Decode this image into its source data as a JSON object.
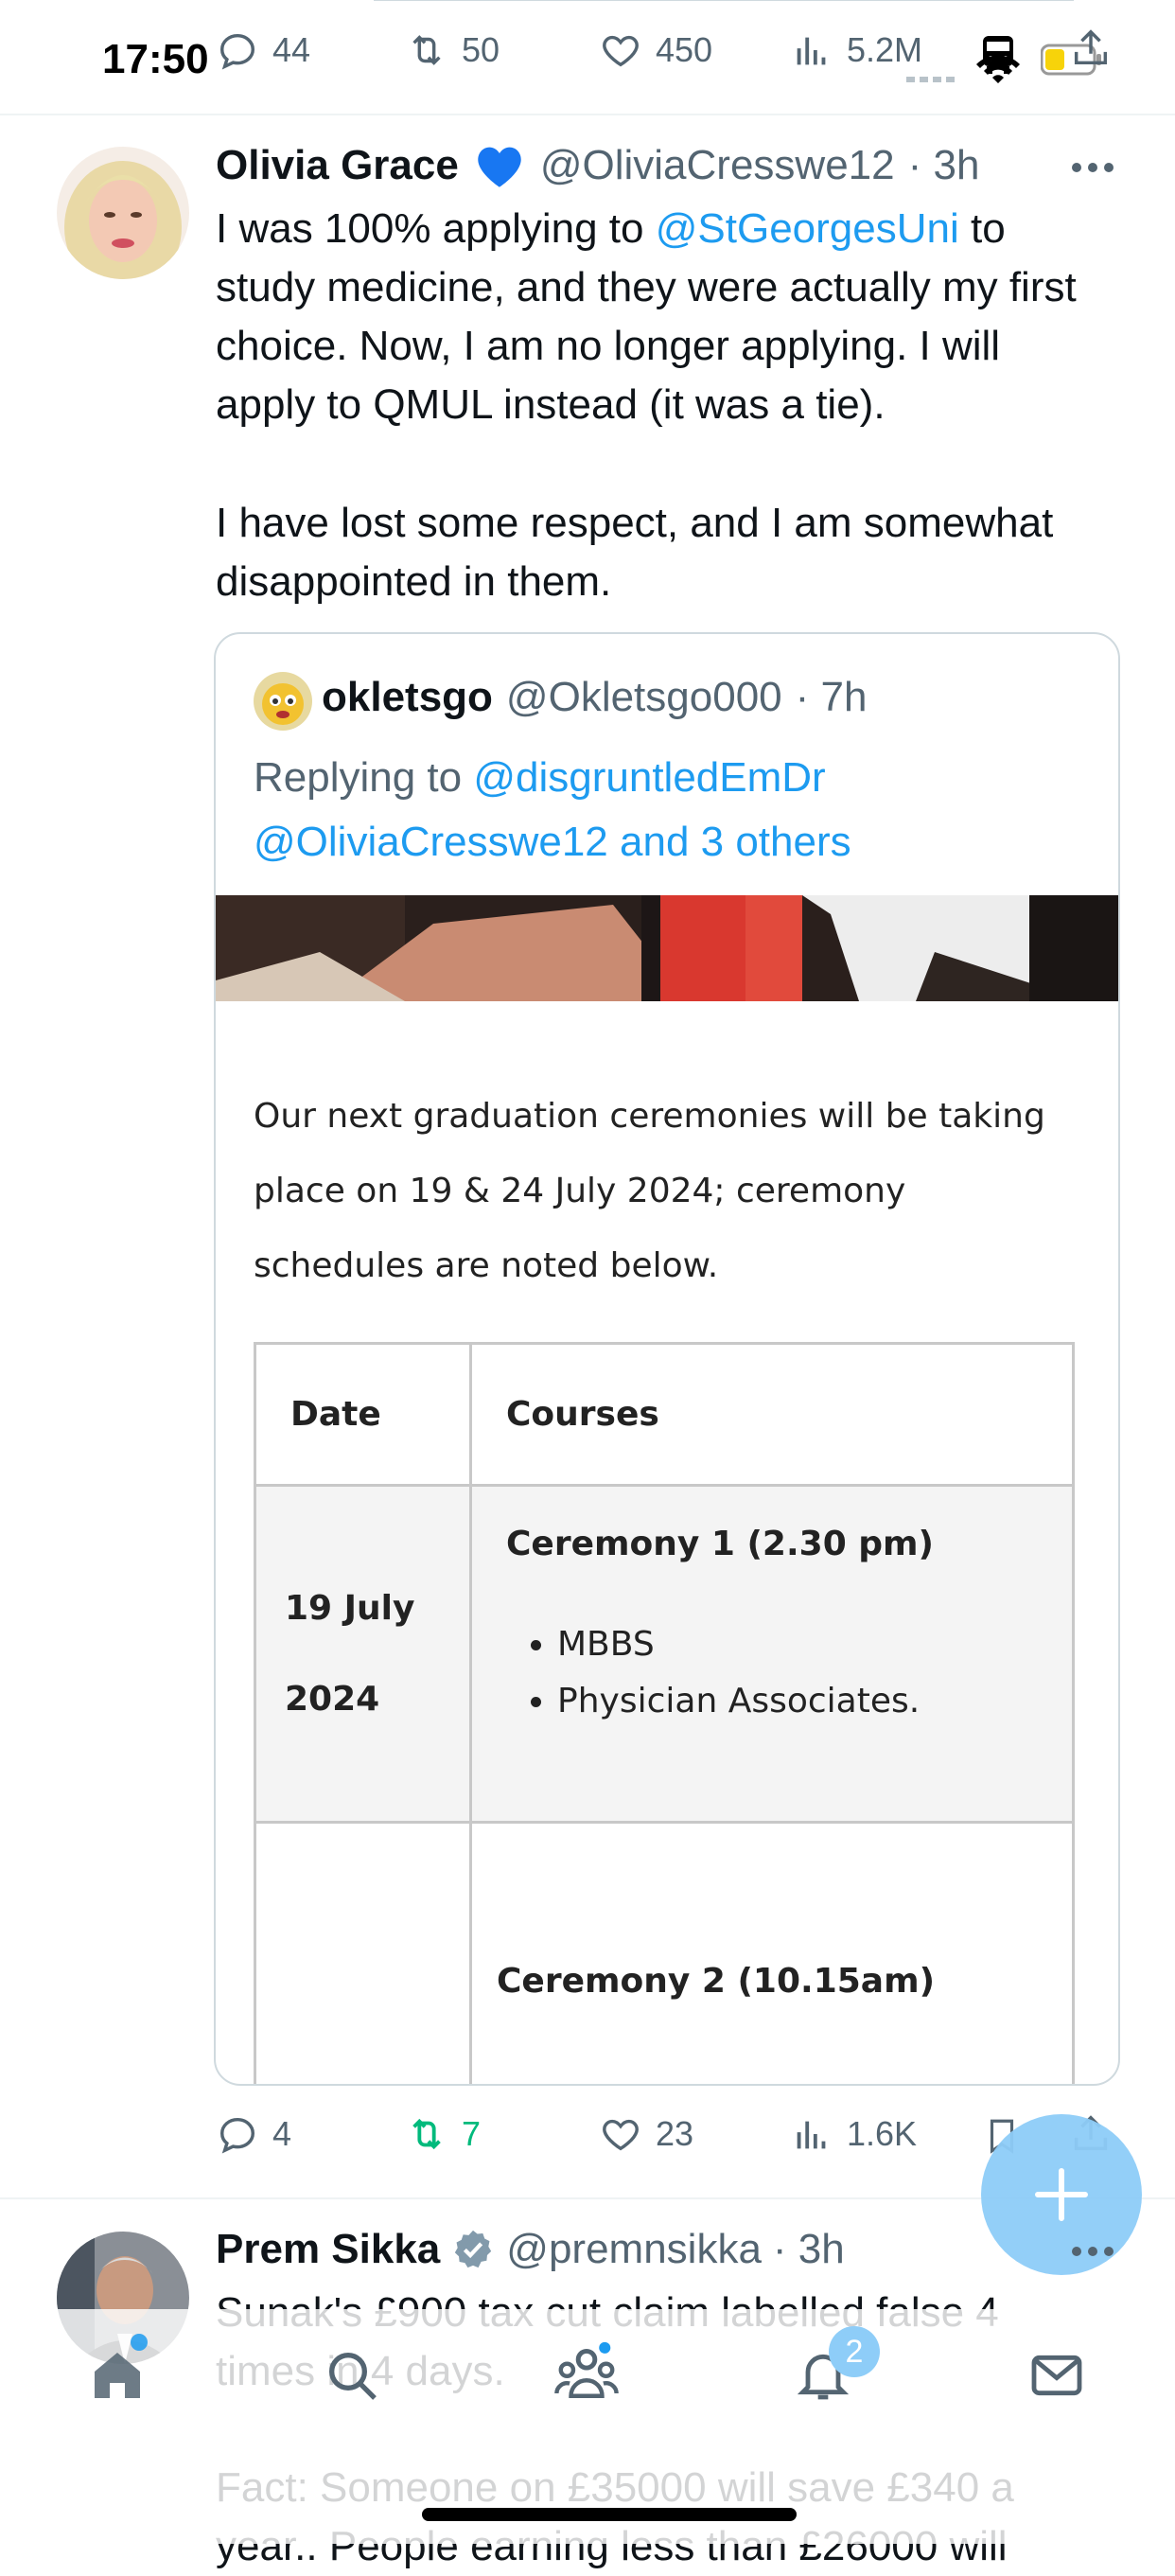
{
  "status": {
    "time": "17:50"
  },
  "prev_tweet_actions": {
    "replies": "44",
    "retweets": "50",
    "likes": "450",
    "views": "5.2M"
  },
  "tweet": {
    "name": "Olivia Grace",
    "handle": "@OliviaCresswe12",
    "time": "· 3h",
    "text_pre": "I was 100% applying to ",
    "mention": "@StGeorgesUni",
    "text_post": " to study medicine, and they were actually my first choice. Now, I am no longer applying. I will apply to QMUL instead (it was a tie).",
    "text_p2": "I have lost some respect, and I am somewhat disappointed in them.",
    "actions": {
      "replies": "4",
      "retweets": "7",
      "likes": "23",
      "views": "1.6K"
    }
  },
  "quote": {
    "name": "okletsgo",
    "handle": "@Okletsgo000",
    "time": "· 7h",
    "replying_prefix": "Replying to ",
    "replying_to": "@disgruntledEmDr",
    "replying_more": "@OliviaCresswe12 and 3 others",
    "doc_intro": "Our next graduation ceremonies will be taking place on 19 & 24 July 2024; ceremony schedules are noted below.",
    "table": {
      "header": [
        "Date",
        "Courses"
      ],
      "row1_date": "19 July 2024",
      "row1_title": "Ceremony 1 (2.30 pm)",
      "row1_items": [
        "MBBS",
        "Physician Associates."
      ],
      "row2_title": "Ceremony 2 (10.15am)"
    }
  },
  "next_tweet": {
    "name": "Prem Sikka",
    "handle": "@premnsikka",
    "time": "· 3h",
    "text_1": "Sunak's £900 tax cut claim labelled false 4 times in 4 days.",
    "text_2": "Fact: Someone on £35000 will save £340 a year.. People earning less than £26000 will"
  },
  "nav": {
    "notifications_badge": "2"
  },
  "colors": {
    "accent": "#1d9bf0",
    "retweet_active": "#00ba7c",
    "muted": "#536471"
  }
}
